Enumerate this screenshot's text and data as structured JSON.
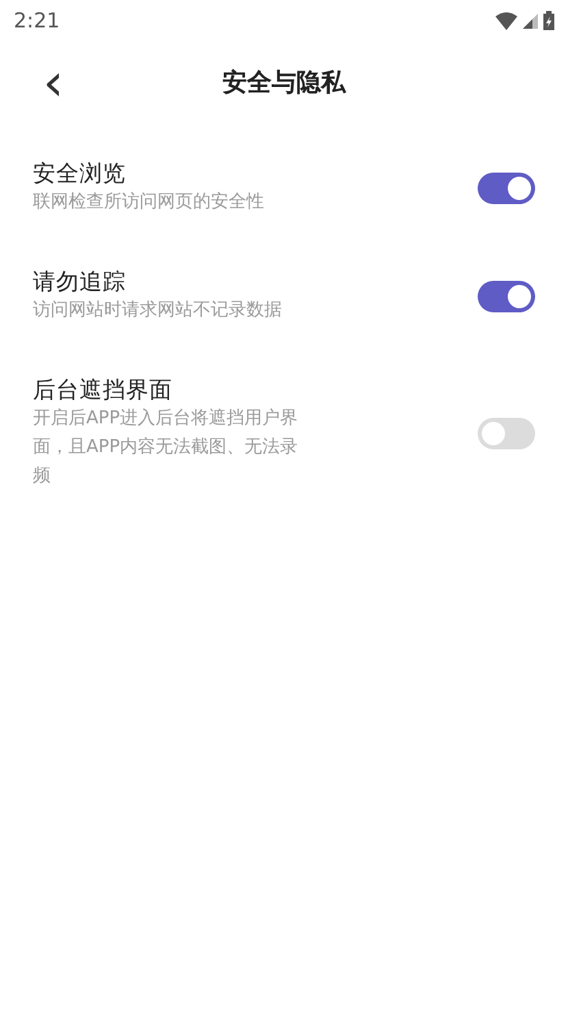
{
  "status_bar": {
    "time": "2:21"
  },
  "header": {
    "back": "‹",
    "title": "安全与隐私"
  },
  "settings": [
    {
      "title": "安全浏览",
      "description": "联网检查所访问网页的安全性",
      "on": true
    },
    {
      "title": "请勿追踪",
      "description": "访问网站时请求网站不记录数据",
      "on": true
    },
    {
      "title": "后台遮挡界面",
      "description": "开启后APP进入后台将遮挡用户界面，且APP内容无法截图、无法录频",
      "on": false
    }
  ]
}
